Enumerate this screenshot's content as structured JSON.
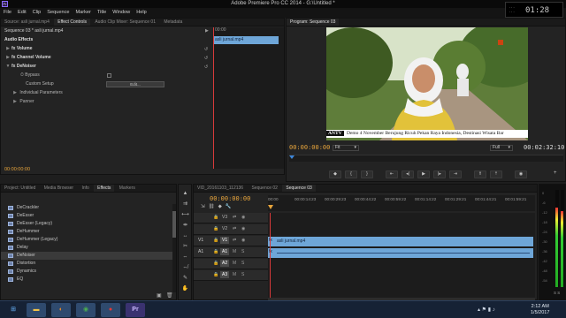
{
  "window": {
    "title": "Adobe Premiere Pro CC 2014 - G:\\Untitled *",
    "app_icon": "Pr"
  },
  "menu": [
    "File",
    "Edit",
    "Clip",
    "Sequence",
    "Marker",
    "Title",
    "Window",
    "Help"
  ],
  "clock_overlay": {
    "time": "01:28",
    "line1": "...",
    "line2": "..."
  },
  "source_panel": {
    "tabs": [
      "Source: asli jurnal.mp4",
      "Effect Controls",
      "Audio Clip Mixer: Sequence 01",
      "Metadata"
    ],
    "active_tab": "Effect Controls",
    "clip_path": "Sequence 03 * asli jurnal.mp4",
    "section_title": "Audio Effects",
    "effects": [
      {
        "name": "Volume"
      },
      {
        "name": "Channel Volume"
      },
      {
        "name": "DeNoiser"
      }
    ],
    "bypass_label": "Bypass",
    "custom_setup_label": "Custom Setup",
    "edit_button": "Edit...",
    "individual_params_label": "Individual Parameters",
    "panner_label": "Panner",
    "ruler_time": "00:00",
    "clip_label": "asli jurnal.mp4",
    "bottom_timecode": "00:00:00:00"
  },
  "program_monitor": {
    "tabs": [
      "Program: Sequence 03"
    ],
    "timecode_current": "00:00:00:00",
    "timecode_duration": "00:02:32:10",
    "fit_label": "Fit",
    "full_label": "Full",
    "ticker_logo": "ANTV",
    "ticker_text": "Demo 4 November Berujung Ricuh      Pekan Raya Indonesia, Destinasi Wisata Bar",
    "transport_buttons": [
      "marker-icon",
      "in-point-icon",
      "out-point-icon",
      "go-to-in-icon",
      "step-back-icon",
      "play-icon",
      "step-forward-icon",
      "go-to-out-icon",
      "lift-icon",
      "extract-icon",
      "export-frame-icon"
    ]
  },
  "project_panel": {
    "tabs": [
      "Project: Untitled",
      "Media Browser",
      "Info",
      "Effects",
      "Markers"
    ],
    "active_tab": "Effects",
    "items": [
      "DeCrackler",
      "DeEsser",
      "DeEsser (Legacy)",
      "DeHummer",
      "DeHummer (Legacy)",
      "Delay",
      "DeNoiser",
      "Distortion",
      "Dynamics",
      "EQ"
    ],
    "selected": "DeNoiser"
  },
  "timeline": {
    "tabs": [
      "VID_20161103_112136",
      "Sequence 02",
      "Sequence 03"
    ],
    "active_tab": "Sequence 03",
    "timecode": "00:00:00:00",
    "ruler": [
      "00:00",
      "00:00:14:23",
      "00:00:29:23",
      "00:00:44:22",
      "00:00:59:22",
      "00:01:14:22",
      "00:01:29:21",
      "00:01:44:21",
      "00:01:59:21"
    ],
    "tracks": [
      {
        "name": "V3",
        "type": "video"
      },
      {
        "name": "V2",
        "type": "video"
      },
      {
        "name": "V1",
        "type": "video",
        "src": "V1"
      },
      {
        "name": "A1",
        "type": "audio",
        "src": "A1"
      },
      {
        "name": "A2",
        "type": "audio"
      },
      {
        "name": "A3",
        "type": "audio"
      }
    ],
    "video_clip": "asli jurnal.mp4",
    "audio_clip_marker": "fx"
  },
  "meters": {
    "scale": [
      "0",
      "-6",
      "-12",
      "-18",
      "-24",
      "-30",
      "-36",
      "-42",
      "-48",
      "-54"
    ],
    "footer": "S  S"
  },
  "taskbar": {
    "apps": [
      "windows-start",
      "explorer",
      "firefox",
      "chrome",
      "record",
      "premiere"
    ],
    "time": "2:12 AM",
    "date": "1/5/2017"
  }
}
